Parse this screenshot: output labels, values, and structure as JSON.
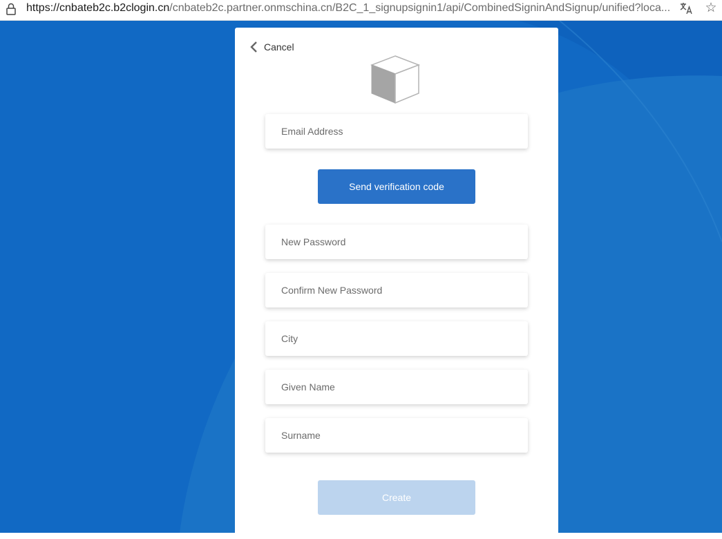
{
  "browser": {
    "url_host": "https://cnbateb2c.b2clogin.cn",
    "url_rest": "/cnbateb2c.partner.onmschina.cn/B2C_1_signupsignin1/api/CombinedSigninAndSignup/unified?loca..."
  },
  "card": {
    "cancel_label": "Cancel",
    "fields": {
      "email_placeholder": "Email Address",
      "new_password_placeholder": "New Password",
      "confirm_password_placeholder": "Confirm New Password",
      "city_placeholder": "City",
      "given_name_placeholder": "Given Name",
      "surname_placeholder": "Surname"
    },
    "send_code_label": "Send verification code",
    "create_label": "Create"
  },
  "colors": {
    "background": "#1169c4",
    "primary_button": "#2a72c8",
    "disabled_button": "#bcd4ee"
  },
  "icons": {
    "lock": "lock-icon",
    "translate": "translate-icon",
    "favorite": "star-icon",
    "back": "chevron-left-icon",
    "logo": "cube-logo-icon"
  }
}
